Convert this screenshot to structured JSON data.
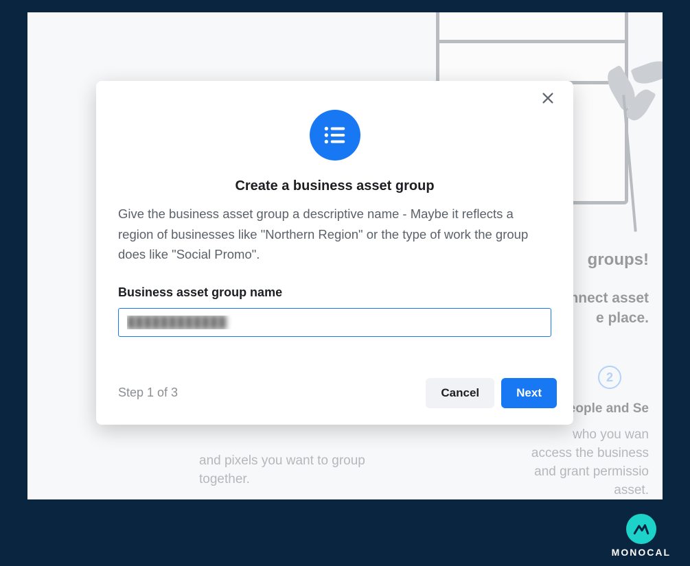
{
  "modal": {
    "title": "Create a business asset group",
    "description": "Give the business asset group a descriptive name - Maybe it reflects a region of businesses like \"Northern Region\" or the type of work the group does like \"Social Promo\".",
    "field_label": "Business asset group name",
    "input_value": "",
    "input_placeholder": "████████████",
    "step_indicator": "Step 1 of 3",
    "cancel_label": "Cancel",
    "next_label": "Next"
  },
  "background": {
    "heading_fragment": "groups!",
    "sub_line1": "nnect asset",
    "sub_line2": "e place.",
    "step2_number": "2",
    "step2_title": "People and Se",
    "step2_line1": "who you wan",
    "step2_line2": "access the business",
    "step2_line3": "and grant permissio",
    "step2_line4": "asset.",
    "left_line1": "and pixels you want to group",
    "left_line2": "together."
  },
  "brand": {
    "name": "MONOCAL"
  }
}
